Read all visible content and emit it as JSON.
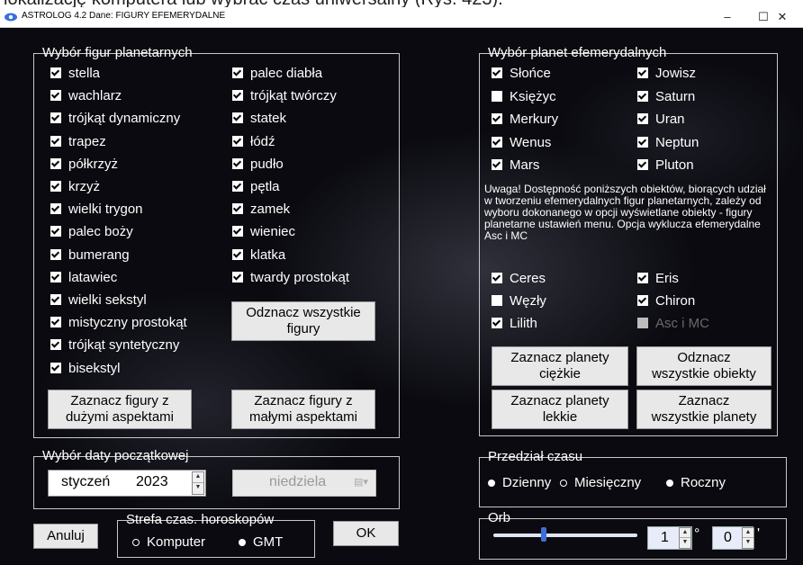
{
  "top_crop_text": "lokalizację komputera lub wybrać czas uniwersalny (Rys. 423).",
  "window": {
    "title": "ASTROLOG 4.2  Dane: FIGURY EFEMERYDALNE",
    "minimize": "–",
    "maximize": "☐",
    "close": "✕"
  },
  "figures_group": {
    "legend": "Wybór figur planetarnych",
    "left": [
      {
        "label": "stella",
        "checked": true
      },
      {
        "label": "wachlarz",
        "checked": true
      },
      {
        "label": "trójkąt dynamiczny",
        "checked": true
      },
      {
        "label": "trapez",
        "checked": true
      },
      {
        "label": "półkrzyż",
        "checked": true
      },
      {
        "label": "krzyż",
        "checked": true
      },
      {
        "label": "wielki trygon",
        "checked": true
      },
      {
        "label": "palec boży",
        "checked": true
      },
      {
        "label": "bumerang",
        "checked": true
      },
      {
        "label": "latawiec",
        "checked": true
      },
      {
        "label": "wielki sekstyl",
        "checked": true
      },
      {
        "label": "mistyczny prostokąt",
        "checked": true
      },
      {
        "label": "trójkąt syntetyczny",
        "checked": true
      },
      {
        "label": "bisekstyl",
        "checked": true
      }
    ],
    "right": [
      {
        "label": "palec diabła",
        "checked": true
      },
      {
        "label": "trójkąt twórczy",
        "checked": true
      },
      {
        "label": "statek",
        "checked": true
      },
      {
        "label": "łódź",
        "checked": true
      },
      {
        "label": "pudło",
        "checked": true
      },
      {
        "label": "pętla",
        "checked": true
      },
      {
        "label": "zamek",
        "checked": true
      },
      {
        "label": "wieniec",
        "checked": true
      },
      {
        "label": "klatka",
        "checked": true
      },
      {
        "label": "twardy prostokąt",
        "checked": true
      }
    ],
    "deselect_all": "Odznacz wszystkie\nfigury",
    "select_major": "Zaznacz figury z\ndużymi aspektami",
    "select_minor": "Zaznacz figury z\nmałymi aspektami"
  },
  "planets_group": {
    "legend": "Wybór planet efemerydalnych",
    "left": [
      {
        "label": "Słońce",
        "checked": true
      },
      {
        "label": "Księżyc",
        "checked": false
      },
      {
        "label": "Merkury",
        "checked": true
      },
      {
        "label": "Wenus",
        "checked": true
      },
      {
        "label": "Mars",
        "checked": true
      }
    ],
    "right": [
      {
        "label": "Jowisz",
        "checked": true
      },
      {
        "label": "Saturn",
        "checked": true
      },
      {
        "label": "Uran",
        "checked": true
      },
      {
        "label": "Neptun",
        "checked": true
      },
      {
        "label": "Pluton",
        "checked": true
      }
    ],
    "note": "Uwaga!  Dostępność poniższych obiektów, biorących udział w tworzeniu efemerydalnych figur planetarnych, zależy od wyboru dokonanego w opcji wyświetlane obiekty - figury planetarne ustawień menu. Opcja wyklucza efemerydalne Asc i MC",
    "objects_left": [
      {
        "label": "Ceres",
        "checked": true
      },
      {
        "label": "Węzły",
        "checked": false
      },
      {
        "label": "Lilith",
        "checked": true
      }
    ],
    "objects_right": [
      {
        "label": "Eris",
        "checked": true
      },
      {
        "label": "Chiron",
        "checked": true
      },
      {
        "label": "Asc i MC",
        "checked": false,
        "disabled": true
      }
    ],
    "select_heavy": "Zaznacz planety\nciężkie",
    "deselect_all_objects": "Odznacz\nwszystkie obiekty",
    "select_light": "Zaznacz planety\nlekkie",
    "select_all_planets": "Zaznacz\nwszystkie planety"
  },
  "date_group": {
    "legend": "Wybór daty początkowej",
    "month": "styczeń",
    "year": "2023",
    "weekday": "niedziela"
  },
  "interval_group": {
    "legend": "Przedział czasu",
    "options": [
      {
        "label": "Dzienny",
        "selected": true
      },
      {
        "label": "Miesięczny",
        "selected": false
      },
      {
        "label": "Roczny",
        "selected": true
      }
    ]
  },
  "timezone_group": {
    "legend": "Strefa czas. horoskopów",
    "options": [
      {
        "label": "Komputer",
        "selected": false
      },
      {
        "label": "GMT",
        "selected": true
      }
    ]
  },
  "orb_group": {
    "legend": "Orb",
    "slider_fraction": 0.35,
    "degrees": "1",
    "degrees_unit": "°",
    "minutes": "0",
    "minutes_unit": "'"
  },
  "buttons": {
    "cancel": "Anuluj",
    "ok": "OK"
  },
  "colors": {
    "accent": "#3a6fd8",
    "spin_field": "#e7ecf8"
  }
}
